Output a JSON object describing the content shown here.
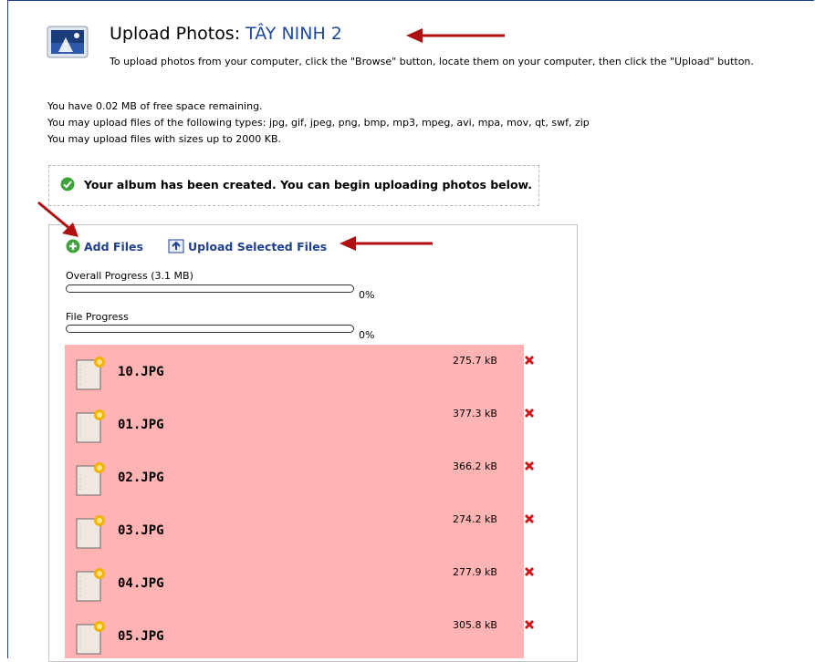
{
  "header": {
    "title_prefix": "Upload Photos: ",
    "album_name": "TÂY NINH 2",
    "instructions": "To upload photos from your computer, click the \"Browse\" button, locate them on your computer, then click the \"Upload\" button."
  },
  "info": {
    "free_space": "You have 0.02 MB of free space remaining.",
    "file_types": "You may upload files of the following types: jpg, gif, jpeg, png, bmp, mp3, mpeg, avi, mpa, mov, qt, swf, zip",
    "max_size": "You may upload files with sizes up to 2000 KB."
  },
  "notice": {
    "message": "Your album has been created. You can begin uploading photos below."
  },
  "actions": {
    "add_files": "Add Files",
    "upload_selected": "Upload Selected Files"
  },
  "progress": {
    "overall_label": "Overall Progress (3.1 MB)",
    "overall_percent": "0%",
    "overall_value": 0,
    "file_label": "File Progress",
    "file_percent": "0%",
    "file_value": 0
  },
  "files": [
    {
      "name": "10.JPG",
      "size": "275.7 kB"
    },
    {
      "name": "01.JPG",
      "size": "377.3 kB"
    },
    {
      "name": "02.JPG",
      "size": "366.2 kB"
    },
    {
      "name": "03.JPG",
      "size": "274.2 kB"
    },
    {
      "name": "04.JPG",
      "size": "277.9 kB"
    },
    {
      "name": "05.JPG",
      "size": "305.8 kB"
    }
  ],
  "colors": {
    "file_list_bg": "#ffb3b3",
    "link": "#1f3f8f",
    "arrow": "#b01010"
  }
}
